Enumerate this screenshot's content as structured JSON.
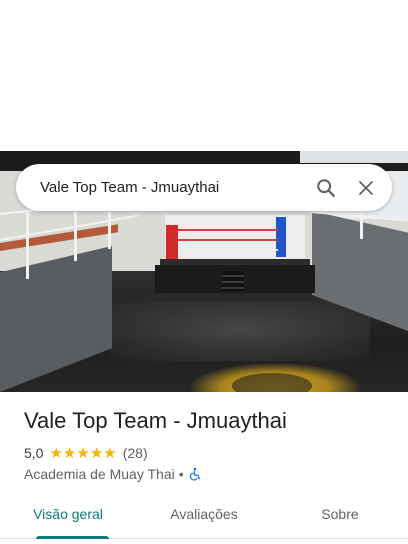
{
  "search": {
    "query": "Vale Top Team - Jmuaythai"
  },
  "place": {
    "title": "Vale Top Team - Jmuaythai",
    "rating": "5,0",
    "stars": 5,
    "reviews": "(28)",
    "category": "Academia de Muay Thai",
    "separator": "•",
    "accessibility_icon": "wheelchair-icon"
  },
  "tabs": [
    {
      "label": "Visão geral",
      "active": true
    },
    {
      "label": "Avaliações",
      "active": false
    },
    {
      "label": "Sobre",
      "active": false
    }
  ],
  "colors": {
    "accent": "#0b7a7a",
    "star": "#f6b400",
    "accessibility": "#1a73e8"
  },
  "icons": {
    "search": "search-icon",
    "close": "close-icon"
  }
}
